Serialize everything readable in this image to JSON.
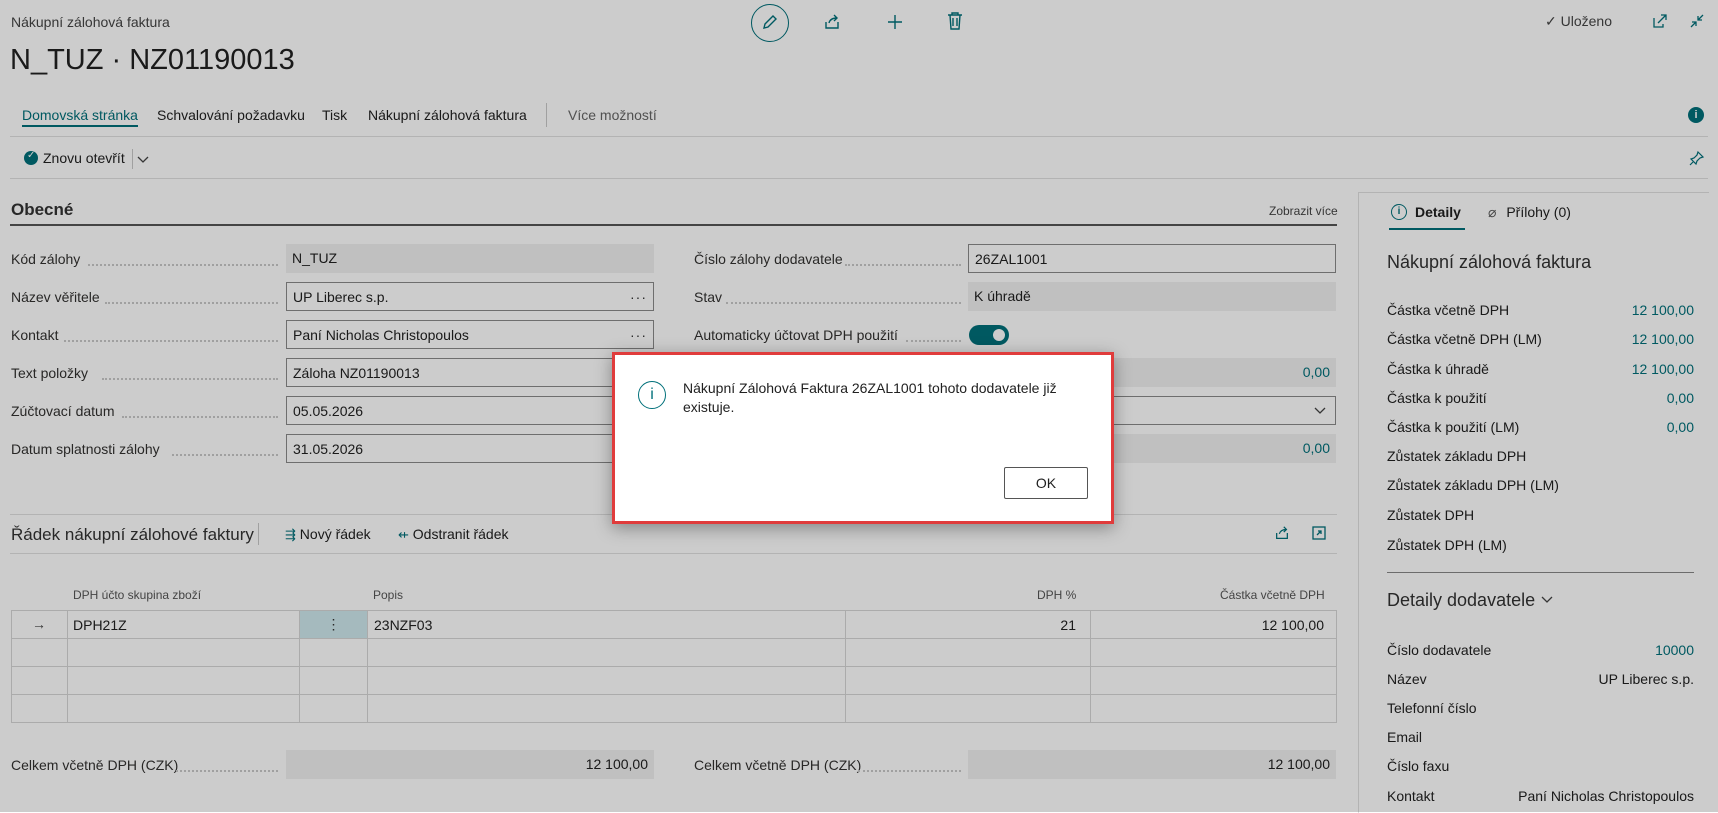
{
  "window": {
    "page_type": "Nákupní zálohová faktura",
    "title": "N_TUZ · NZ01190013",
    "saved_label": "Uloženo"
  },
  "nav_tabs": [
    {
      "label": "Domovská stránka",
      "active": true
    },
    {
      "label": "Schvalování požadavku"
    },
    {
      "label": "Tisk"
    },
    {
      "label": "Nákupní zálohová faktura"
    },
    {
      "label": "Více možností"
    }
  ],
  "actions": {
    "reopen_label": "Znovu otevřít"
  },
  "general": {
    "section_title": "Obecné",
    "show_more": "Zobrazit více",
    "left_fields": [
      {
        "label": "Kód zálohy",
        "value": "N_TUZ"
      },
      {
        "label": "Název věřitele",
        "value": "UP Liberec s.p."
      },
      {
        "label": "Kontakt",
        "value": "Paní Nicholas Christopoulos"
      },
      {
        "label": "Text položky",
        "value": "Záloha NZ01190013"
      },
      {
        "label": "Zúčtovací datum",
        "value": "05.05.2026"
      },
      {
        "label": "Datum splatnosti zálohy",
        "value": "31.05.2026"
      }
    ],
    "right_fields": [
      {
        "label": "Číslo zálohy dodavatele",
        "value": "26ZAL1001"
      },
      {
        "label": "Stav",
        "value": "K úhradě"
      },
      {
        "label": "Automaticky účtovat DPH použití",
        "value": ""
      },
      {
        "label": "",
        "value": "0,00"
      },
      {
        "label": "",
        "value": ""
      },
      {
        "label": "",
        "value": "0,00"
      }
    ]
  },
  "lines": {
    "title": "Řádek nákupní zálohové faktury",
    "new_line": "Nový řádek",
    "delete_line": "Odstranit řádek",
    "columns": [
      "DPH účto skupina zboží",
      "Popis",
      "DPH %",
      "Částka včetně DPH"
    ],
    "rows": [
      {
        "group": "DPH21Z",
        "description": "23NZF03",
        "vat_pct": "21",
        "amount": "12 100,00"
      }
    ]
  },
  "totals": {
    "left_label": "Celkem včetně DPH (CZK)",
    "left_value": "12 100,00",
    "right_label": "Celkem včetně DPH (CZK)",
    "right_value": "12 100,00"
  },
  "factbox": {
    "tab_details": "Detaily",
    "tab_attachments": "Přílohy (0)",
    "invoice_title": "Nákupní zálohová faktura",
    "invoice_rows": [
      {
        "label": "Částka včetně DPH",
        "value": "12 100,00"
      },
      {
        "label": "Částka včetně DPH (LM)",
        "value": "12 100,00"
      },
      {
        "label": "Částka k úhradě",
        "value": "12 100,00"
      },
      {
        "label": "Částka k použití",
        "value": "0,00"
      },
      {
        "label": "Částka k použití (LM)",
        "value": "0,00"
      },
      {
        "label": "Zůstatek základu DPH",
        "value": ""
      },
      {
        "label": "Zůstatek základu DPH (LM)",
        "value": ""
      },
      {
        "label": "Zůstatek DPH",
        "value": ""
      },
      {
        "label": "Zůstatek DPH (LM)",
        "value": ""
      }
    ],
    "vendor_title": "Detaily dodavatele",
    "vendor_rows": [
      {
        "label": "Číslo dodavatele",
        "value": "10000"
      },
      {
        "label": "Název",
        "value": "UP Liberec s.p."
      },
      {
        "label": "Telefonní číslo",
        "value": ""
      },
      {
        "label": "Email",
        "value": ""
      },
      {
        "label": "Číslo faxu",
        "value": ""
      },
      {
        "label": "Kontakt",
        "value": "Paní Nicholas Christopoulos"
      }
    ]
  },
  "dialog": {
    "message": "Nákupní Zálohová Faktura 26ZAL1001 tohoto dodavatele již existuje.",
    "ok_label": "OK"
  },
  "colors": {
    "accent": "#00707a",
    "dialog_border": "#e03c3c"
  }
}
